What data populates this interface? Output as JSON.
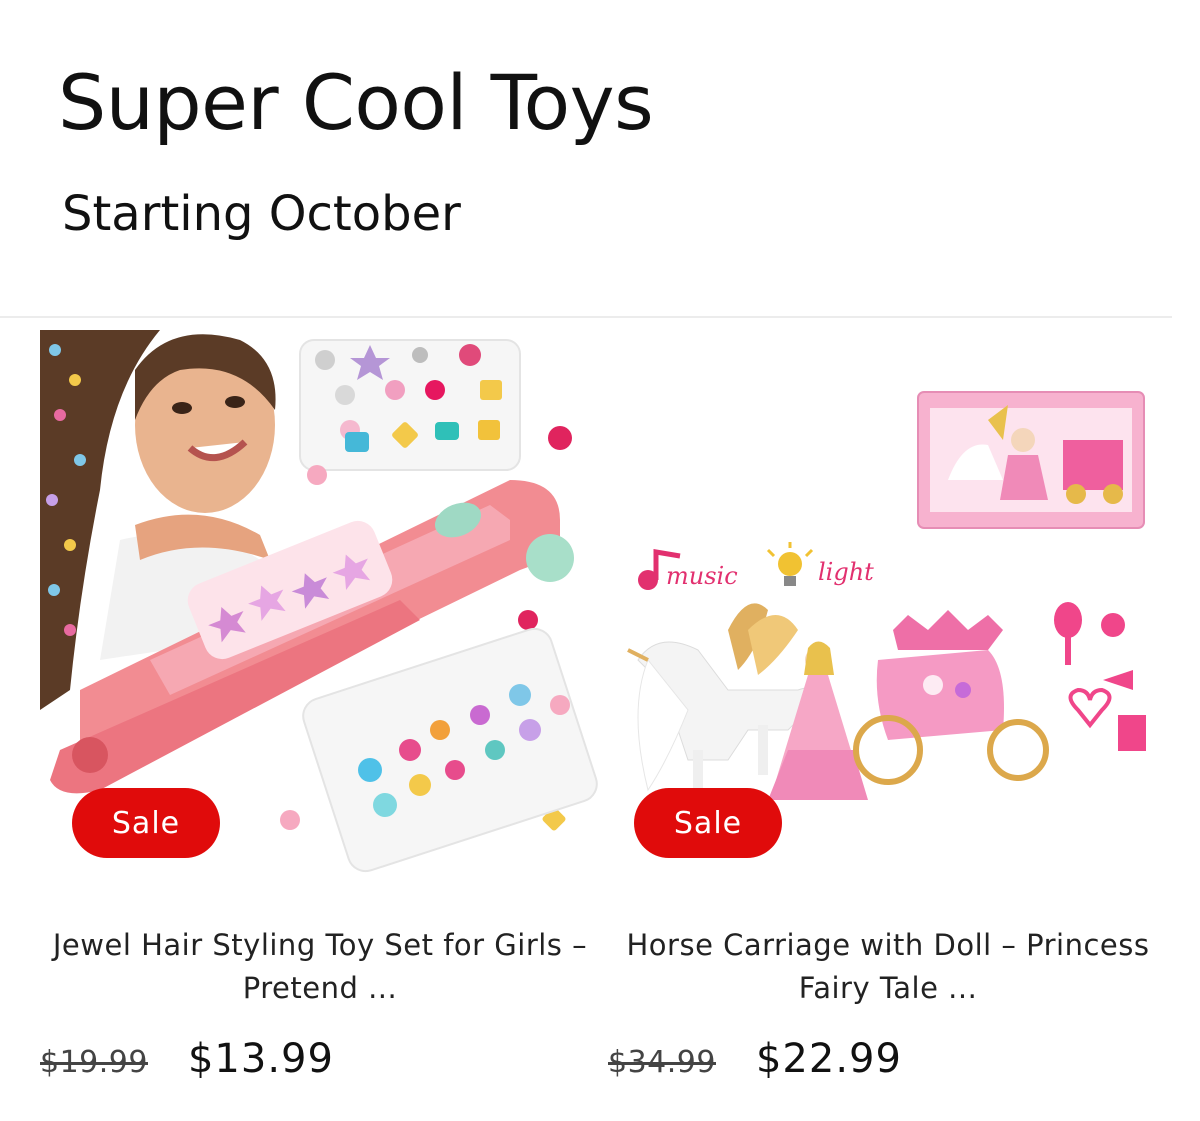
{
  "header": {
    "title": "Super Cool Toys",
    "subtitle": "Starting October"
  },
  "products": [
    {
      "badge": "Sale",
      "title": "Jewel Hair Styling Toy Set for Girls – Pretend ...",
      "price_old": "$19.99",
      "price_new": "$13.99",
      "image": "girl-with-pink-hair-jeweler-tool-and-gem-trays"
    },
    {
      "badge": "Sale",
      "title": "Horse Carriage with Doll – Princess Fairy Tale ...",
      "price_old": "$34.99",
      "price_new": "$22.99",
      "image": "unicorn-pulling-pink-carriage-with-doll-and-accessories",
      "image_labels": {
        "music": "music",
        "light": "light"
      }
    }
  ],
  "colors": {
    "sale_badge": "#e00b0b",
    "toy_pink": "#f07b86",
    "carriage_pink": "#f59ac4"
  }
}
